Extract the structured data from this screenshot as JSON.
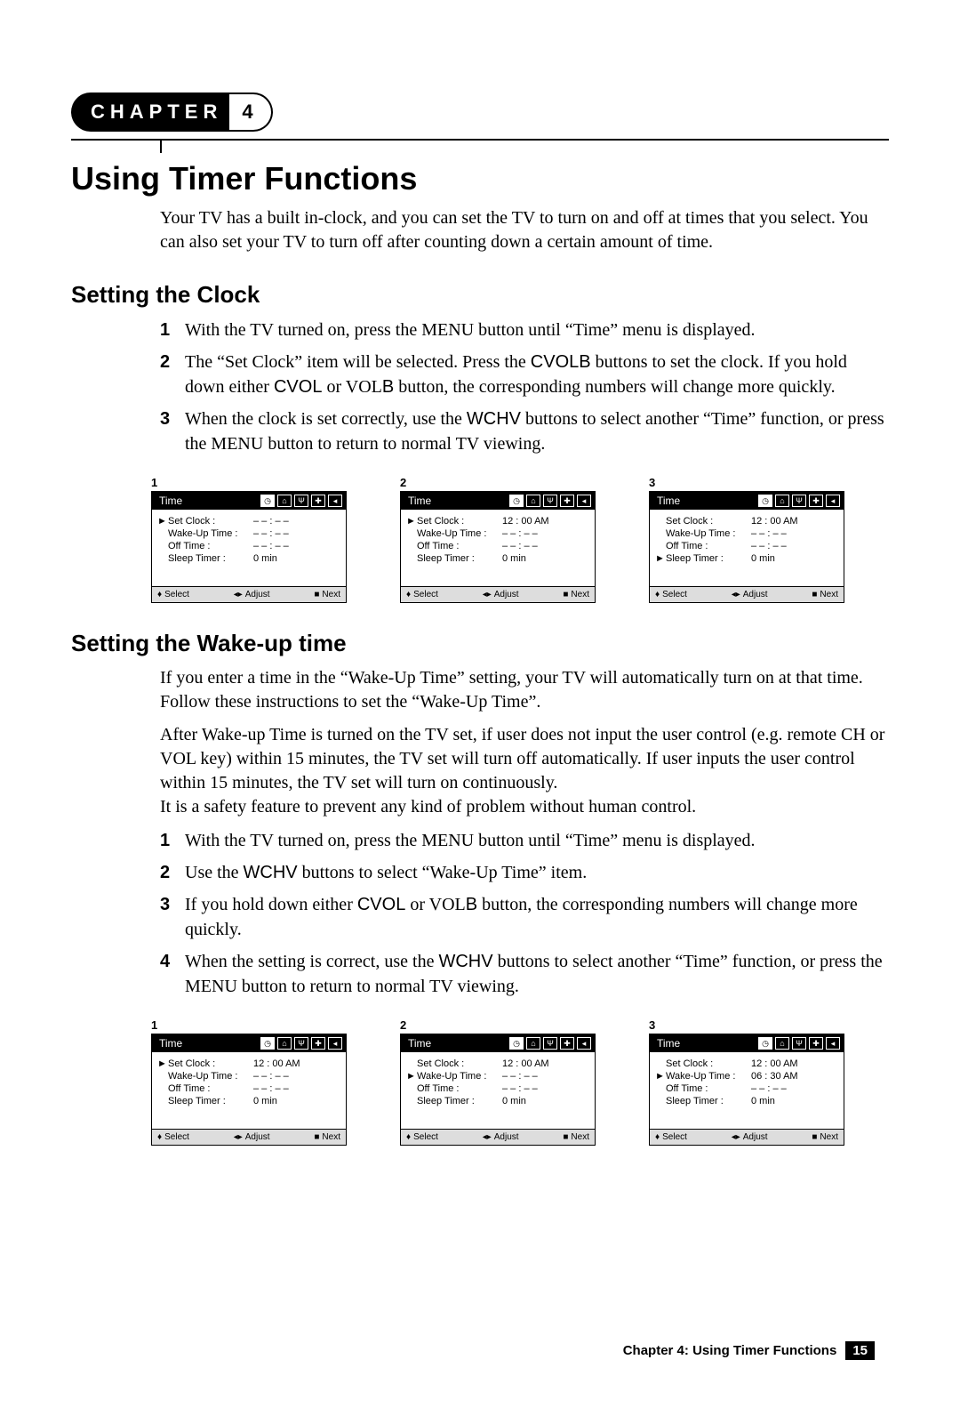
{
  "chapter": {
    "label": "CHAPTER",
    "number": "4"
  },
  "title": "Using Timer Functions",
  "intro": "Your TV has a built in-clock, and you can set the TV to turn on and off at times that you select. You can also set your TV to turn off after counting down a certain amount of time.",
  "section1": {
    "heading": "Setting the Clock",
    "steps": [
      "With the TV turned on, press the MENU button until “Time” menu is displayed.",
      "The “Set Clock” item will be selected. Press the CVOLB buttons to set the clock. If you hold down either CVOL or VOLB button, the corresponding numbers will change more quickly.",
      "When the clock is set correctly, use the WCHV buttons to select another “Time” function, or press the MENU button to return to normal TV viewing."
    ]
  },
  "section2": {
    "heading": "Setting the Wake-up time",
    "p1": "If you enter a time in the “Wake-Up Time” setting, your TV will automatically turn on at that time. Follow these instructions to set the “Wake-Up Time”.",
    "p2": "After Wake-up Time is turned on the TV set, if user does not input the user control (e.g. remote CH or VOL key) within 15 minutes, the TV set will turn off automatically. If user inputs the user control within 15 minutes, the TV set will turn on continuously.",
    "p3": "It is a safety feature to prevent any kind of problem without human control.",
    "steps": [
      "With the TV turned on, press the MENU button until “Time” menu is displayed.",
      "Use the WCHV buttons to select “Wake-Up Time” item.",
      "If you hold down either CVOL or VOLB button, the corresponding numbers will change more quickly.",
      "When the setting is correct, use the WCHV buttons to select another “Time” function, or press the MENU button to return to normal TV viewing."
    ]
  },
  "osd_common": {
    "title": "Time",
    "footer": {
      "select": "Select",
      "adjust": "Adjust",
      "next": "Next"
    },
    "labels": {
      "set_clock": "Set Clock :",
      "wake": "Wake-Up Time :",
      "off": "Off Time :",
      "sleep": "Sleep Timer :"
    }
  },
  "osd_set1": [
    {
      "num": "1",
      "selected": 0,
      "values": {
        "set_clock": "– – : – –",
        "wake": "– – : – –",
        "off": "– – : – –",
        "sleep": "0 min"
      }
    },
    {
      "num": "2",
      "selected": 0,
      "values": {
        "set_clock": "12 : 00 AM",
        "wake": "– – : – –",
        "off": "– – : – –",
        "sleep": "0 min"
      }
    },
    {
      "num": "3",
      "selected": 3,
      "values": {
        "set_clock": "12 : 00 AM",
        "wake": "– – : – –",
        "off": "– – : – –",
        "sleep": "0 min"
      }
    }
  ],
  "osd_set2": [
    {
      "num": "1",
      "selected": 0,
      "values": {
        "set_clock": "12 : 00 AM",
        "wake": "– – : – –",
        "off": "– – : – –",
        "sleep": "0 min"
      }
    },
    {
      "num": "2",
      "selected": 1,
      "values": {
        "set_clock": "12 : 00 AM",
        "wake": "– – : – –",
        "off": "– – : – –",
        "sleep": "0 min"
      }
    },
    {
      "num": "3",
      "selected": 1,
      "values": {
        "set_clock": "12 : 00 AM",
        "wake": "06 : 30 AM",
        "off": "– – : – –",
        "sleep": "0 min"
      }
    }
  ],
  "footer": {
    "text": "Chapter 4: Using Timer Functions",
    "page": "15"
  }
}
